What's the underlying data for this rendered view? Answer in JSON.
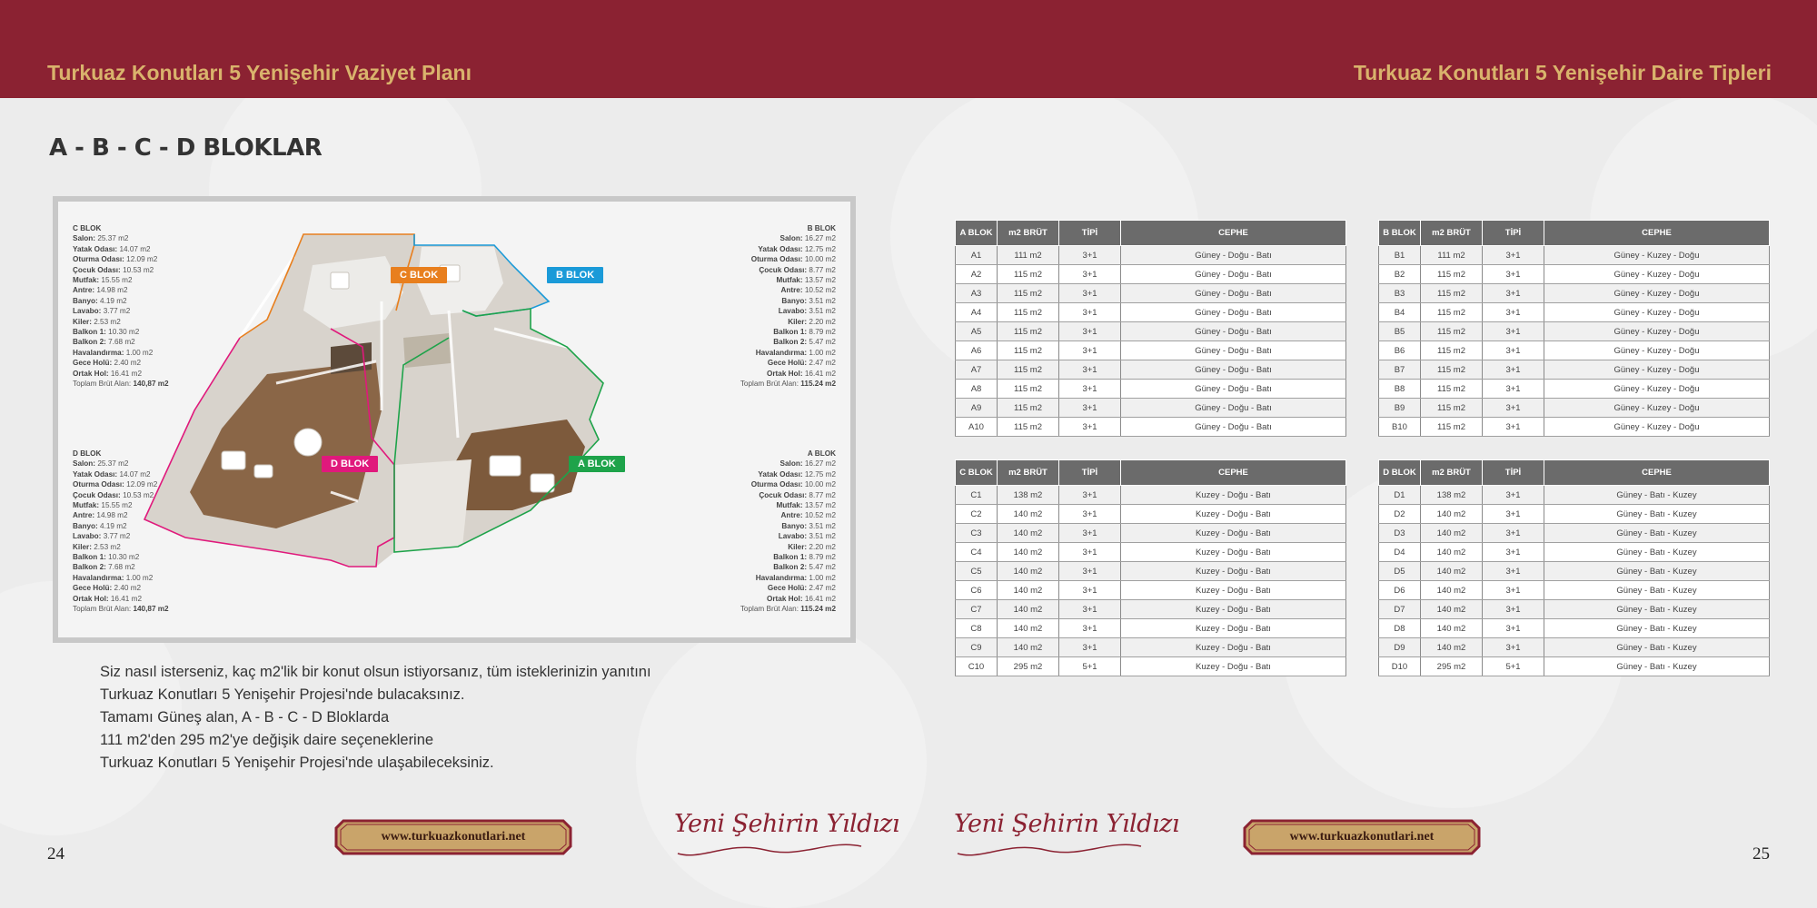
{
  "header": {
    "left_title": "Turkuaz Konutları 5 Yenişehir Vaziyet Planı",
    "right_title": "Turkuaz Konutları 5 Yenişehir Daire Tipleri"
  },
  "section_title": "A - B - C - D BLOKLAR",
  "plan": {
    "labels": {
      "c": "C BLOK",
      "b": "B BLOK",
      "d": "D BLOK",
      "a": "A BLOK"
    },
    "c_info": {
      "title": "C BLOK",
      "rows": [
        {
          "k": "Salon:",
          "v": "25.37 m2"
        },
        {
          "k": "Yatak Odası:",
          "v": "14.07 m2"
        },
        {
          "k": "Oturma Odası:",
          "v": "12.09 m2"
        },
        {
          "k": "Çocuk Odası:",
          "v": "10.53 m2"
        },
        {
          "k": "Mutfak:",
          "v": "15.55 m2"
        },
        {
          "k": "Antre:",
          "v": "14.98 m2"
        },
        {
          "k": "Banyo:",
          "v": "4.19 m2"
        },
        {
          "k": "Lavabo:",
          "v": "3.77 m2"
        },
        {
          "k": "Kiler:",
          "v": "2.53 m2"
        },
        {
          "k": "Balkon 1:",
          "v": "10.30 m2"
        },
        {
          "k": "Balkon 2:",
          "v": "7.68 m2"
        },
        {
          "k": "Havalandırma:",
          "v": "1.00 m2"
        },
        {
          "k": "Gece Holü:",
          "v": "2.40 m2"
        },
        {
          "k": "Ortak Hol:",
          "v": "16.41 m2"
        }
      ],
      "total_label": "Toplam Brüt Alan:",
      "total": "140,87 m2"
    },
    "d_info": {
      "title": "D BLOK",
      "rows": [
        {
          "k": "Salon:",
          "v": "25.37 m2"
        },
        {
          "k": "Yatak Odası:",
          "v": "14.07 m2"
        },
        {
          "k": "Oturma Odası:",
          "v": "12.09 m2"
        },
        {
          "k": "Çocuk Odası:",
          "v": "10.53 m2"
        },
        {
          "k": "Mutfak:",
          "v": "15.55 m2"
        },
        {
          "k": "Antre:",
          "v": "14.98 m2"
        },
        {
          "k": "Banyo:",
          "v": "4.19 m2"
        },
        {
          "k": "Lavabo:",
          "v": "3.77 m2"
        },
        {
          "k": "Kiler:",
          "v": "2.53 m2"
        },
        {
          "k": "Balkon 1:",
          "v": "10.30 m2"
        },
        {
          "k": "Balkon 2:",
          "v": "7.68 m2"
        },
        {
          "k": "Havalandırma:",
          "v": "1.00 m2"
        },
        {
          "k": "Gece Holü:",
          "v": "2.40 m2"
        },
        {
          "k": "Ortak Hol:",
          "v": "16.41 m2"
        }
      ],
      "total_label": "Toplam Brüt Alan:",
      "total": "140,87 m2"
    },
    "b_info": {
      "title": "B BLOK",
      "rows": [
        {
          "k": "Salon:",
          "v": "16.27 m2"
        },
        {
          "k": "Yatak Odası:",
          "v": "12.75 m2"
        },
        {
          "k": "Oturma Odası:",
          "v": "10.00 m2"
        },
        {
          "k": "Çocuk Odası:",
          "v": "8.77 m2"
        },
        {
          "k": "Mutfak:",
          "v": "13.57 m2"
        },
        {
          "k": "Antre:",
          "v": "10.52 m2"
        },
        {
          "k": "Banyo:",
          "v": "3.51 m2"
        },
        {
          "k": "Lavabo:",
          "v": "3.51 m2"
        },
        {
          "k": "Kiler:",
          "v": "2.20 m2"
        },
        {
          "k": "Balkon 1:",
          "v": "8.79 m2"
        },
        {
          "k": "Balkon 2:",
          "v": "5.47 m2"
        },
        {
          "k": "Havalandırma:",
          "v": "1.00 m2"
        },
        {
          "k": "Gece Holü:",
          "v": "2.47 m2"
        },
        {
          "k": "Ortak Hol:",
          "v": "16.41 m2"
        }
      ],
      "total_label": "Toplam Brüt Alan:",
      "total": "115.24 m2"
    },
    "a_info": {
      "title": "A BLOK",
      "rows": [
        {
          "k": "Salon:",
          "v": "16.27 m2"
        },
        {
          "k": "Yatak Odası:",
          "v": "12.75 m2"
        },
        {
          "k": "Oturma Odası:",
          "v": "10.00 m2"
        },
        {
          "k": "Çocuk Odası:",
          "v": "8.77 m2"
        },
        {
          "k": "Mutfak:",
          "v": "13.57 m2"
        },
        {
          "k": "Antre:",
          "v": "10.52 m2"
        },
        {
          "k": "Banyo:",
          "v": "3.51 m2"
        },
        {
          "k": "Lavabo:",
          "v": "3.51 m2"
        },
        {
          "k": "Kiler:",
          "v": "2.20 m2"
        },
        {
          "k": "Balkon 1:",
          "v": "8.79 m2"
        },
        {
          "k": "Balkon 2:",
          "v": "5.47 m2"
        },
        {
          "k": "Havalandırma:",
          "v": "1.00 m2"
        },
        {
          "k": "Gece Holü:",
          "v": "2.47 m2"
        },
        {
          "k": "Ortak Hol:",
          "v": "16.41 m2"
        }
      ],
      "total_label": "Toplam Brüt Alan:",
      "total": "115.24 m2"
    },
    "colors": {
      "c": "#e87f1e",
      "b": "#1a9ad8",
      "d": "#e0197c",
      "a": "#1ea34a"
    }
  },
  "intro_lines": [
    "Siz nasıl isterseniz, kaç m2'lik bir konut olsun istiyorsanız, tüm isteklerinizin yanıtını",
    "Turkuaz Konutları 5 Yenişehir Projesi'nde bulacaksınız.",
    "Tamamı Güneş alan, A - B - C - D Bloklarda",
    "111 m2'den 295 m2'ye  değişik daire seçeneklerine",
    "Turkuaz Konutları 5 Yenişehir Projesi'nde ulaşabileceksiniz."
  ],
  "tables": {
    "a": {
      "headers": [
        "A BLOK",
        "m2 BRÜT",
        "TİPİ",
        "CEPHE"
      ],
      "rows": [
        [
          "A1",
          "111 m2",
          "3+1",
          "Güney - Doğu - Batı"
        ],
        [
          "A2",
          "115 m2",
          "3+1",
          "Güney - Doğu - Batı"
        ],
        [
          "A3",
          "115 m2",
          "3+1",
          "Güney - Doğu - Batı"
        ],
        [
          "A4",
          "115 m2",
          "3+1",
          "Güney - Doğu - Batı"
        ],
        [
          "A5",
          "115 m2",
          "3+1",
          "Güney - Doğu - Batı"
        ],
        [
          "A6",
          "115 m2",
          "3+1",
          "Güney - Doğu - Batı"
        ],
        [
          "A7",
          "115 m2",
          "3+1",
          "Güney - Doğu - Batı"
        ],
        [
          "A8",
          "115 m2",
          "3+1",
          "Güney - Doğu - Batı"
        ],
        [
          "A9",
          "115 m2",
          "3+1",
          "Güney - Doğu - Batı"
        ],
        [
          "A10",
          "115 m2",
          "3+1",
          "Güney - Doğu - Batı"
        ]
      ]
    },
    "b": {
      "headers": [
        "B BLOK",
        "m2 BRÜT",
        "TİPİ",
        "CEPHE"
      ],
      "rows": [
        [
          "B1",
          "111 m2",
          "3+1",
          "Güney - Kuzey - Doğu"
        ],
        [
          "B2",
          "115 m2",
          "3+1",
          "Güney - Kuzey - Doğu"
        ],
        [
          "B3",
          "115 m2",
          "3+1",
          "Güney - Kuzey - Doğu"
        ],
        [
          "B4",
          "115 m2",
          "3+1",
          "Güney - Kuzey - Doğu"
        ],
        [
          "B5",
          "115 m2",
          "3+1",
          "Güney - Kuzey - Doğu"
        ],
        [
          "B6",
          "115 m2",
          "3+1",
          "Güney - Kuzey - Doğu"
        ],
        [
          "B7",
          "115 m2",
          "3+1",
          "Güney - Kuzey - Doğu"
        ],
        [
          "B8",
          "115 m2",
          "3+1",
          "Güney - Kuzey - Doğu"
        ],
        [
          "B9",
          "115 m2",
          "3+1",
          "Güney - Kuzey - Doğu"
        ],
        [
          "B10",
          "115 m2",
          "3+1",
          "Güney - Kuzey - Doğu"
        ]
      ]
    },
    "c": {
      "headers": [
        "C BLOK",
        "m2 BRÜT",
        "TİPİ",
        "CEPHE"
      ],
      "rows": [
        [
          "C1",
          "138 m2",
          "3+1",
          "Kuzey - Doğu - Batı"
        ],
        [
          "C2",
          "140 m2",
          "3+1",
          "Kuzey - Doğu - Batı"
        ],
        [
          "C3",
          "140 m2",
          "3+1",
          "Kuzey - Doğu - Batı"
        ],
        [
          "C4",
          "140 m2",
          "3+1",
          "Kuzey - Doğu - Batı"
        ],
        [
          "C5",
          "140 m2",
          "3+1",
          "Kuzey - Doğu - Batı"
        ],
        [
          "C6",
          "140 m2",
          "3+1",
          "Kuzey - Doğu - Batı"
        ],
        [
          "C7",
          "140 m2",
          "3+1",
          "Kuzey - Doğu - Batı"
        ],
        [
          "C8",
          "140 m2",
          "3+1",
          "Kuzey - Doğu - Batı"
        ],
        [
          "C9",
          "140 m2",
          "3+1",
          "Kuzey - Doğu - Batı"
        ],
        [
          "C10",
          "295 m2",
          "5+1",
          "Kuzey - Doğu - Batı"
        ]
      ]
    },
    "d": {
      "headers": [
        "D BLOK",
        "m2 BRÜT",
        "TİPİ",
        "CEPHE"
      ],
      "rows": [
        [
          "D1",
          "138 m2",
          "3+1",
          "Güney - Batı - Kuzey"
        ],
        [
          "D2",
          "140 m2",
          "3+1",
          "Güney - Batı - Kuzey"
        ],
        [
          "D3",
          "140 m2",
          "3+1",
          "Güney - Batı - Kuzey"
        ],
        [
          "D4",
          "140 m2",
          "3+1",
          "Güney - Batı - Kuzey"
        ],
        [
          "D5",
          "140 m2",
          "3+1",
          "Güney - Batı - Kuzey"
        ],
        [
          "D6",
          "140 m2",
          "3+1",
          "Güney - Batı - Kuzey"
        ],
        [
          "D7",
          "140 m2",
          "3+1",
          "Güney - Batı - Kuzey"
        ],
        [
          "D8",
          "140 m2",
          "3+1",
          "Güney - Batı - Kuzey"
        ],
        [
          "D9",
          "140 m2",
          "3+1",
          "Güney - Batı - Kuzey"
        ],
        [
          "D10",
          "295 m2",
          "5+1",
          "Güney - Batı - Kuzey"
        ]
      ]
    }
  },
  "footer": {
    "page_left": "24",
    "page_right": "25",
    "url_left": "www.turkuazkonutlari.net",
    "url_right": "www.turkuazkonutlari.net",
    "brand_left": "Yeni Şehirin Yıldızı",
    "brand_right": "Yeni Şehirin Yıldızı"
  },
  "colors": {
    "header_bg": "#8b2232",
    "header_text": "#d9b36c",
    "table_header": "#6b6b6b",
    "badge_fill": "#c9a46a"
  }
}
